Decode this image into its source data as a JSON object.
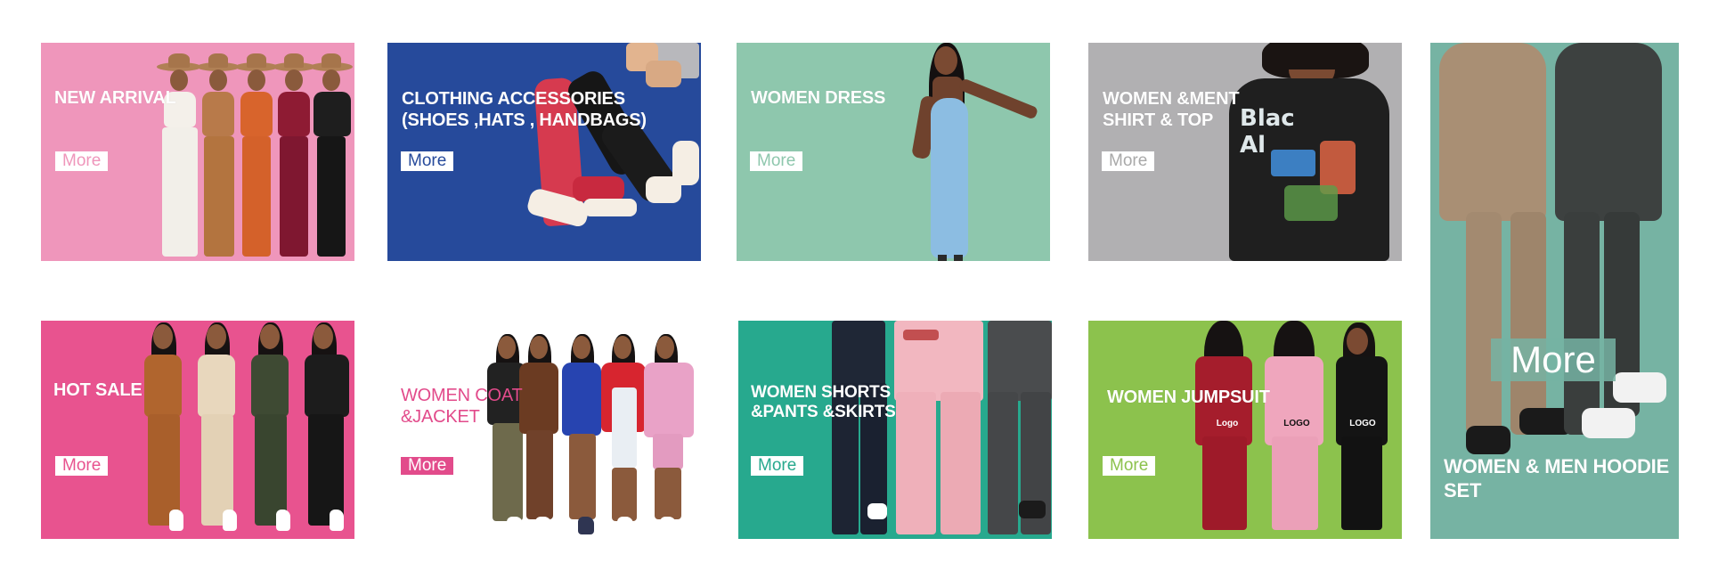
{
  "tiles": [
    {
      "id": "new-arrival",
      "label": "NEW ARRIVAL",
      "button": "More",
      "bg": "#ef96bb",
      "btn_text_color": "#ef96bb"
    },
    {
      "id": "clothing-accessories",
      "label": "CLOTHING ACCESSORIES\n(SHOES ,HATS , HANDBAGS)",
      "button": "More",
      "bg": "#264a9b",
      "btn_text_color": "#264a9b"
    },
    {
      "id": "women-dress",
      "label": "WOMEN DRESS",
      "button": "More",
      "bg": "#8ec7ad",
      "btn_text_color": "#8ec7ad"
    },
    {
      "id": "women-ment-shirt",
      "label": "WOMEN &MENT\nSHIRT & TOP",
      "button": "More",
      "bg": "#b1b0b2",
      "btn_text_color": "#a9a9a9"
    },
    {
      "id": "hoodie-set",
      "label": "WOMEN & MEN HOODIE\nSET",
      "button": "More",
      "bg": "#76b3a3",
      "btn_text_color": "#ffffff"
    },
    {
      "id": "hot-sale",
      "label": "HOT SALE",
      "button": "More",
      "bg": "#e8538f",
      "btn_text_color": "#e8538f"
    },
    {
      "id": "women-coat",
      "label": "WOMEN COAT\n&JACKET",
      "button": "More",
      "bg": "#ffffff",
      "label_color": "#e24b8b",
      "btn_bg": "#e24b8b",
      "btn_text_color": "#ffffff"
    },
    {
      "id": "women-shorts",
      "label": "WOMEN SHORTS\n&PANTS &SKIRTS",
      "button": "More",
      "bg": "#27a98e",
      "btn_text_color": "#27a98e"
    },
    {
      "id": "women-jumpsuit",
      "label": "WOMEN JUMPSUIT",
      "button": "More",
      "bg": "#8cc24d",
      "btn_text_color": "#8cc24d"
    }
  ],
  "logos": [
    "Logo",
    "LOGO",
    "LOGO"
  ],
  "tee_print": "Blac\nAl"
}
